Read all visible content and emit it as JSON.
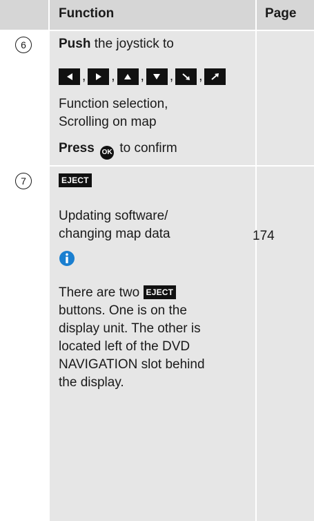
{
  "header": {
    "function_label": "Function",
    "page_label": "Page"
  },
  "rows": [
    {
      "number": "6",
      "push_bold": "Push",
      "push_rest": " the joystick to",
      "separator": ",",
      "keys": [
        "arrow-left-icon",
        "arrow-right-icon",
        "arrow-up-icon",
        "arrow-down-icon",
        "arrow-diagonal-down-right-icon",
        "arrow-diagonal-up-right-icon"
      ],
      "desc_line1": "Function selection,",
      "desc_line2": "Scrolling on map",
      "press_bold": "Press",
      "ok_label": "OK",
      "press_rest": " to confirm",
      "page": ""
    },
    {
      "number": "7",
      "eject_label": "EJECT",
      "desc_line1": "Updating software/",
      "desc_line2": "changing map data",
      "page": "174",
      "note_line1_prefix": "There are two ",
      "note_eject_label": "EJECT",
      "note_line2": "buttons. One is on the",
      "note_line3": "display unit. The other is",
      "note_line4": "located left of the DVD",
      "note_line5": "NAVIGATION slot behind",
      "note_line6": "the display."
    }
  ],
  "colors": {
    "header_bg": "#d6d6d6",
    "cell_bg": "#e6e6e6",
    "key_bg": "#111111",
    "info_icon": "#1a7fd0"
  }
}
